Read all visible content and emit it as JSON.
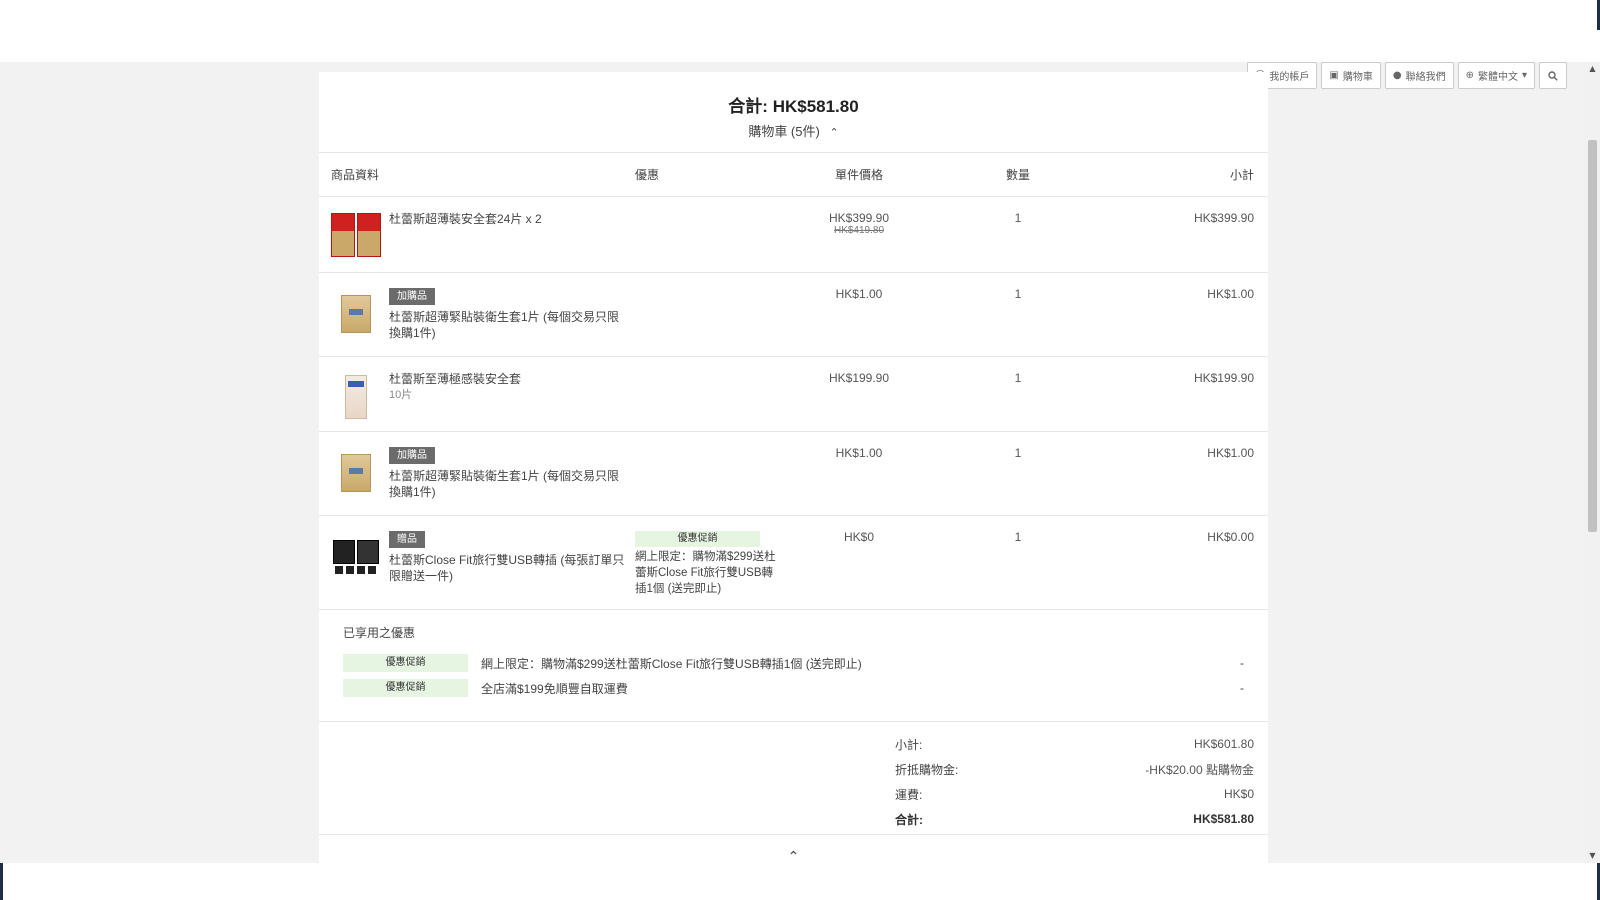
{
  "nav": {
    "account": "我的帳戶",
    "cart": "購物車",
    "contact": "聯絡我們",
    "language": "繁體中文",
    "icons": [
      "user-circle-icon",
      "cart-icon",
      "chat-icon",
      "globe-icon",
      "search-icon"
    ]
  },
  "summary": {
    "total_label": "合計:",
    "total_value": "HK$581.80",
    "cart_label": "購物車 (5件)"
  },
  "table": {
    "headers": {
      "product": "商品資料",
      "promo": "優惠",
      "unit_price": "單件價格",
      "qty": "數量",
      "subtotal": "小計"
    },
    "rows": [
      {
        "tag": "",
        "name": "杜蕾斯超薄裝安全套24片 x 2",
        "sub": "",
        "promo_badge": "",
        "promo_text": "",
        "price": "HK$399.90",
        "old_price": "HK$419.80",
        "qty": "1",
        "subtotal": "HK$399.90"
      },
      {
        "tag": "加購品",
        "name": "杜蕾斯超薄緊貼裝衛生套1片 (每個交易只限換購1件)",
        "sub": "",
        "promo_badge": "",
        "promo_text": "",
        "price": "HK$1.00",
        "old_price": "",
        "qty": "1",
        "subtotal": "HK$1.00"
      },
      {
        "tag": "",
        "name": "杜蕾斯至薄極感裝安全套",
        "sub": "10片",
        "promo_badge": "",
        "promo_text": "",
        "price": "HK$199.90",
        "old_price": "",
        "qty": "1",
        "subtotal": "HK$199.90"
      },
      {
        "tag": "加購品",
        "name": "杜蕾斯超薄緊貼裝衛生套1片 (每個交易只限換購1件)",
        "sub": "",
        "promo_badge": "",
        "promo_text": "",
        "price": "HK$1.00",
        "old_price": "",
        "qty": "1",
        "subtotal": "HK$1.00"
      },
      {
        "tag": "贈品",
        "name": "杜蕾斯Close Fit旅行雙USB轉插 (每張訂單只限贈送一件)",
        "sub": "",
        "promo_badge": "優惠促銷",
        "promo_text": "網上限定：購物滿$299送杜蕾斯Close Fit旅行雙USB轉插1個 (送完即止)",
        "price": "HK$0",
        "old_price": "",
        "qty": "1",
        "subtotal": "HK$0.00"
      }
    ]
  },
  "applied": {
    "title": "已享用之優惠",
    "items": [
      {
        "badge": "優惠促銷",
        "desc": "網上限定：購物滿$299送杜蕾斯Close Fit旅行雙USB轉插1個 (送完即止)",
        "value": "-"
      },
      {
        "badge": "優惠促銷",
        "desc": "全店滿$199免順豐自取運費",
        "value": "-"
      }
    ]
  },
  "totals": {
    "subtotal_label": "小計:",
    "subtotal_value": "HK$601.80",
    "credit_label": "折抵購物金:",
    "credit_value": "-HK$20.00 點購物金",
    "shipping_label": "運費:",
    "shipping_value": "HK$0",
    "total_label": "合計:",
    "total_value": "HK$581.80"
  }
}
